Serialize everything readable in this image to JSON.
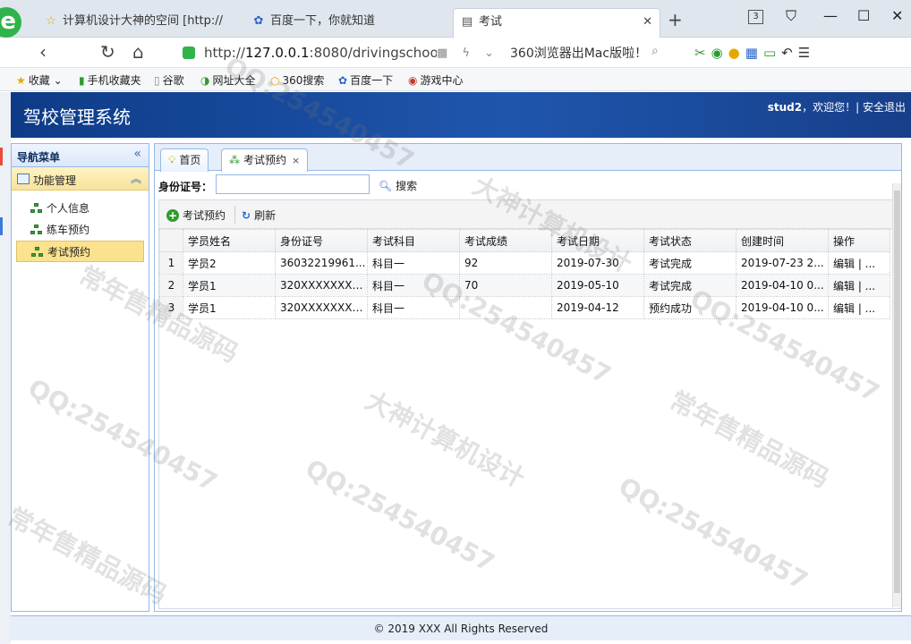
{
  "browser": {
    "tabs": [
      {
        "label": "计算机设计大神的空间 [http://2(",
        "icon": "star-icon"
      },
      {
        "label": "百度一下，你就知道",
        "icon": "paw-icon"
      },
      {
        "label": "考试",
        "icon": "chart-icon",
        "active": true
      }
    ],
    "tab_count": "3",
    "url_prefix": "http://",
    "url_host": "127.0.0.1",
    "url_rest": ":8080/drivingschool/",
    "promo": "360浏览器出Mac版啦！",
    "bookmarks": [
      "收藏",
      "手机收藏夹",
      "谷歌",
      "网址大全",
      "360搜索",
      "百度一下",
      "游戏中心"
    ]
  },
  "app": {
    "title": "驾校管理系统",
    "user": "stud2",
    "welcome": "，欢迎您！| ",
    "logout": "安全退出"
  },
  "sidebar": {
    "title": "导航菜单",
    "group": "功能管理",
    "items": [
      {
        "label": "个人信息",
        "active": false
      },
      {
        "label": "练车预约",
        "active": false
      },
      {
        "label": "考试预约",
        "active": true
      }
    ]
  },
  "main": {
    "tabs": [
      {
        "label": "首页"
      },
      {
        "label": "考试预约",
        "closable": true
      }
    ],
    "search_label": "身份证号：",
    "search_value": "",
    "search_button": "搜索",
    "toolbar": {
      "add": "考试预约",
      "refresh": "刷新"
    },
    "columns": [
      "学员姓名",
      "身份证号",
      "考试科目",
      "考试成绩",
      "考试日期",
      "考试状态",
      "创建时间",
      "操作"
    ],
    "rows": [
      {
        "no": "1",
        "cells": [
          "学员2",
          "36032219961...",
          "科目一",
          "92",
          "2019-07-30",
          "考试完成",
          "2019-07-23 2...",
          "编辑 | ..."
        ]
      },
      {
        "no": "2",
        "cells": [
          "学员1",
          "320XXXXXXXX...",
          "科目一",
          "70",
          "2019-05-10",
          "考试完成",
          "2019-04-10 0...",
          "编辑 | ..."
        ]
      },
      {
        "no": "3",
        "cells": [
          "学员1",
          "320XXXXXXXX...",
          "科目一",
          "",
          "2019-04-12",
          "预约成功",
          "2019-04-10 0...",
          "编辑 | ..."
        ]
      }
    ]
  },
  "footer": "© 2019 XXX All Rights Reserved",
  "watermark": {
    "lines": [
      "QQ:254540457",
      "大神计算机设计",
      "常年售精品源码"
    ]
  },
  "colors": {
    "header_blue": "#1f56ad",
    "panel_border": "#95b8e7",
    "active_item": "#fbe28e"
  }
}
